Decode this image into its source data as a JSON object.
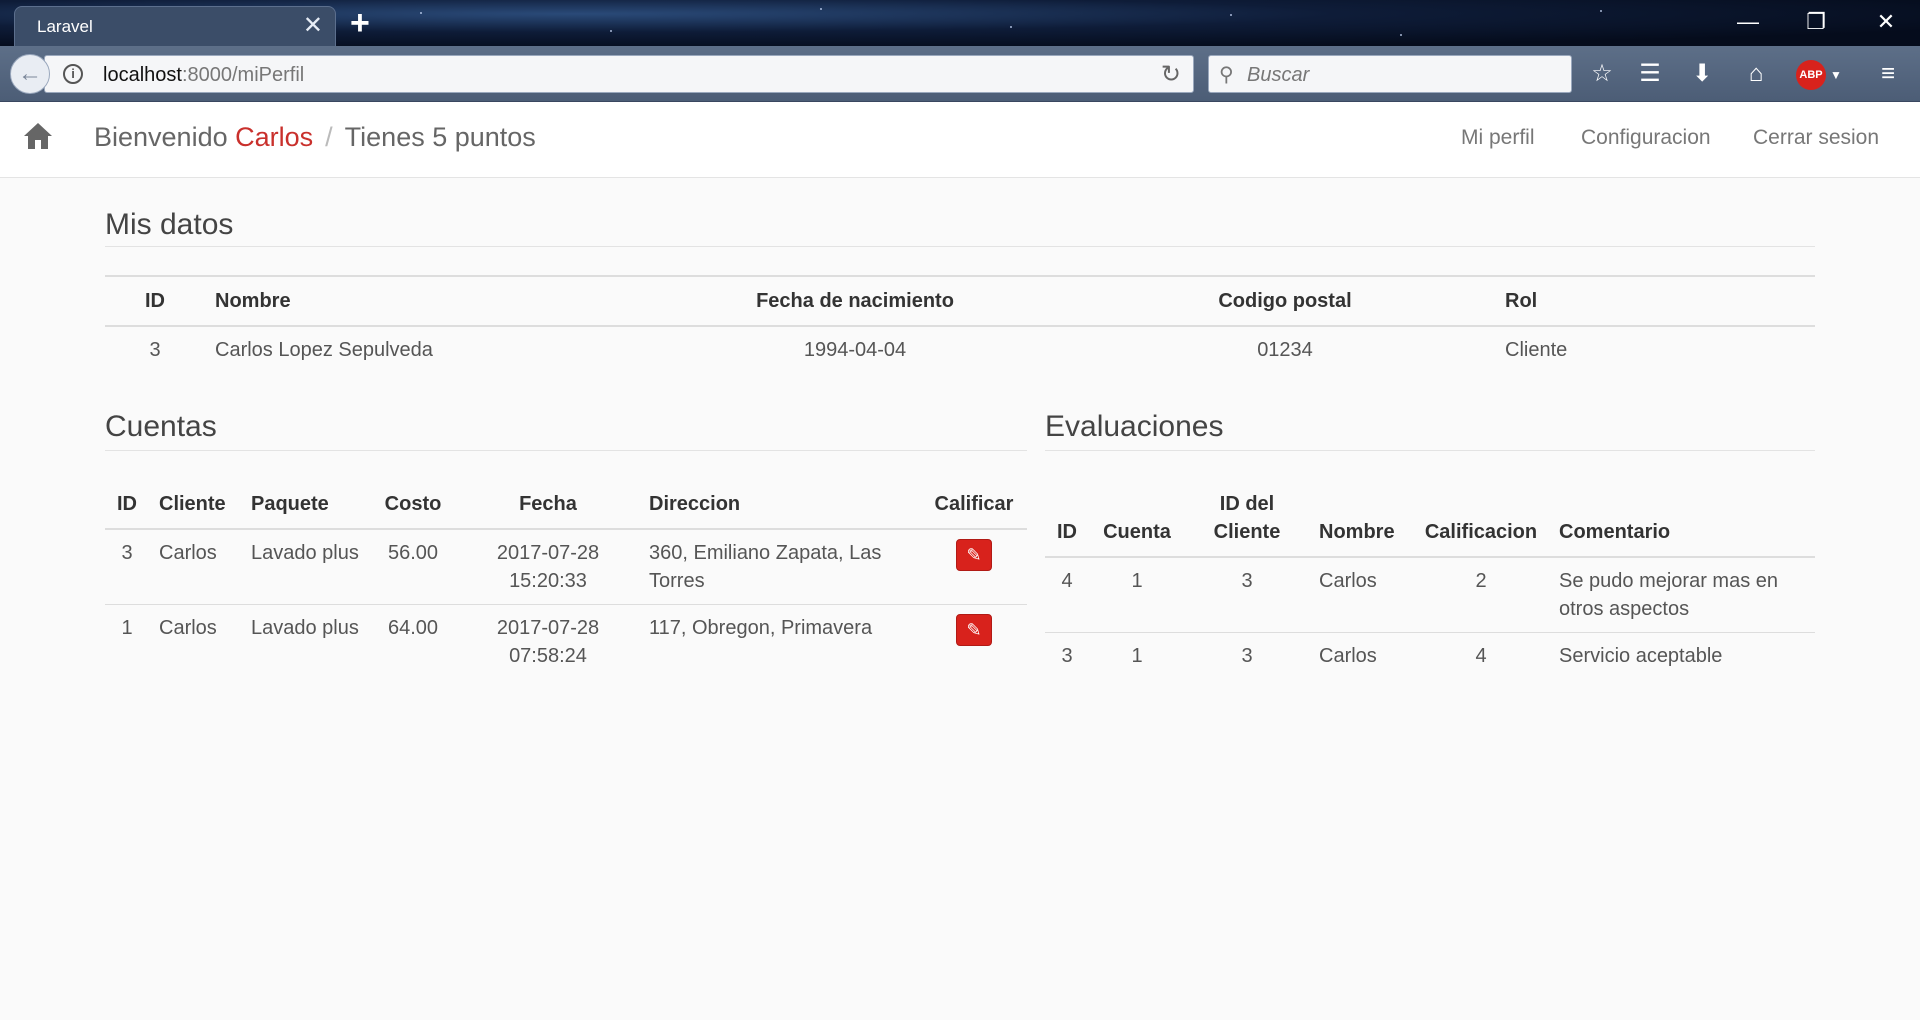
{
  "browser": {
    "tab_title": "Laravel",
    "url_host": "localhost",
    "url_path": ":8000/miPerfil",
    "search_placeholder": "Buscar",
    "adblock_label": "ABP"
  },
  "navbar": {
    "welcome": "Bienvenido",
    "user_name": "Carlos",
    "separator": "/",
    "points": "Tienes 5 puntos",
    "links": [
      "Mi perfil",
      "Configuracion",
      "Cerrar sesion"
    ]
  },
  "mis_datos": {
    "title": "Mis datos",
    "headers": [
      "ID",
      "Nombre",
      "Fecha de nacimiento",
      "Codigo postal",
      "Rol"
    ],
    "row": [
      "3",
      "Carlos Lopez Sepulveda",
      "1994-04-04",
      "01234",
      "Cliente"
    ]
  },
  "cuentas": {
    "title": "Cuentas",
    "headers": [
      "ID",
      "Cliente",
      "Paquete",
      "Costo",
      "Fecha",
      "Direccion",
      "Calificar"
    ],
    "rows": [
      {
        "id": "3",
        "cliente": "Carlos",
        "paquete": "Lavado plus",
        "costo": "56.00",
        "fecha": "2017-07-28 15:20:33",
        "direccion": "360, Emiliano Zapata, Las Torres"
      },
      {
        "id": "1",
        "cliente": "Carlos",
        "paquete": "Lavado plus",
        "costo": "64.00",
        "fecha": "2017-07-28 07:58:24",
        "direccion": "117, Obregon, Primavera"
      }
    ]
  },
  "evaluaciones": {
    "title": "Evaluaciones",
    "headers": [
      "ID",
      "Cuenta",
      "ID del Cliente",
      "Nombre",
      "Calificacion",
      "Comentario"
    ],
    "rows": [
      {
        "id": "4",
        "cuenta": "1",
        "id_cliente": "3",
        "nombre": "Carlos",
        "calificacion": "2",
        "comentario": "Se pudo mejorar mas en otros aspectos"
      },
      {
        "id": "3",
        "cuenta": "1",
        "id_cliente": "3",
        "nombre": "Carlos",
        "calificacion": "4",
        "comentario": "Servicio aceptable"
      }
    ]
  },
  "colors": {
    "accent": "#c9302c",
    "button_red": "#d8221c"
  }
}
